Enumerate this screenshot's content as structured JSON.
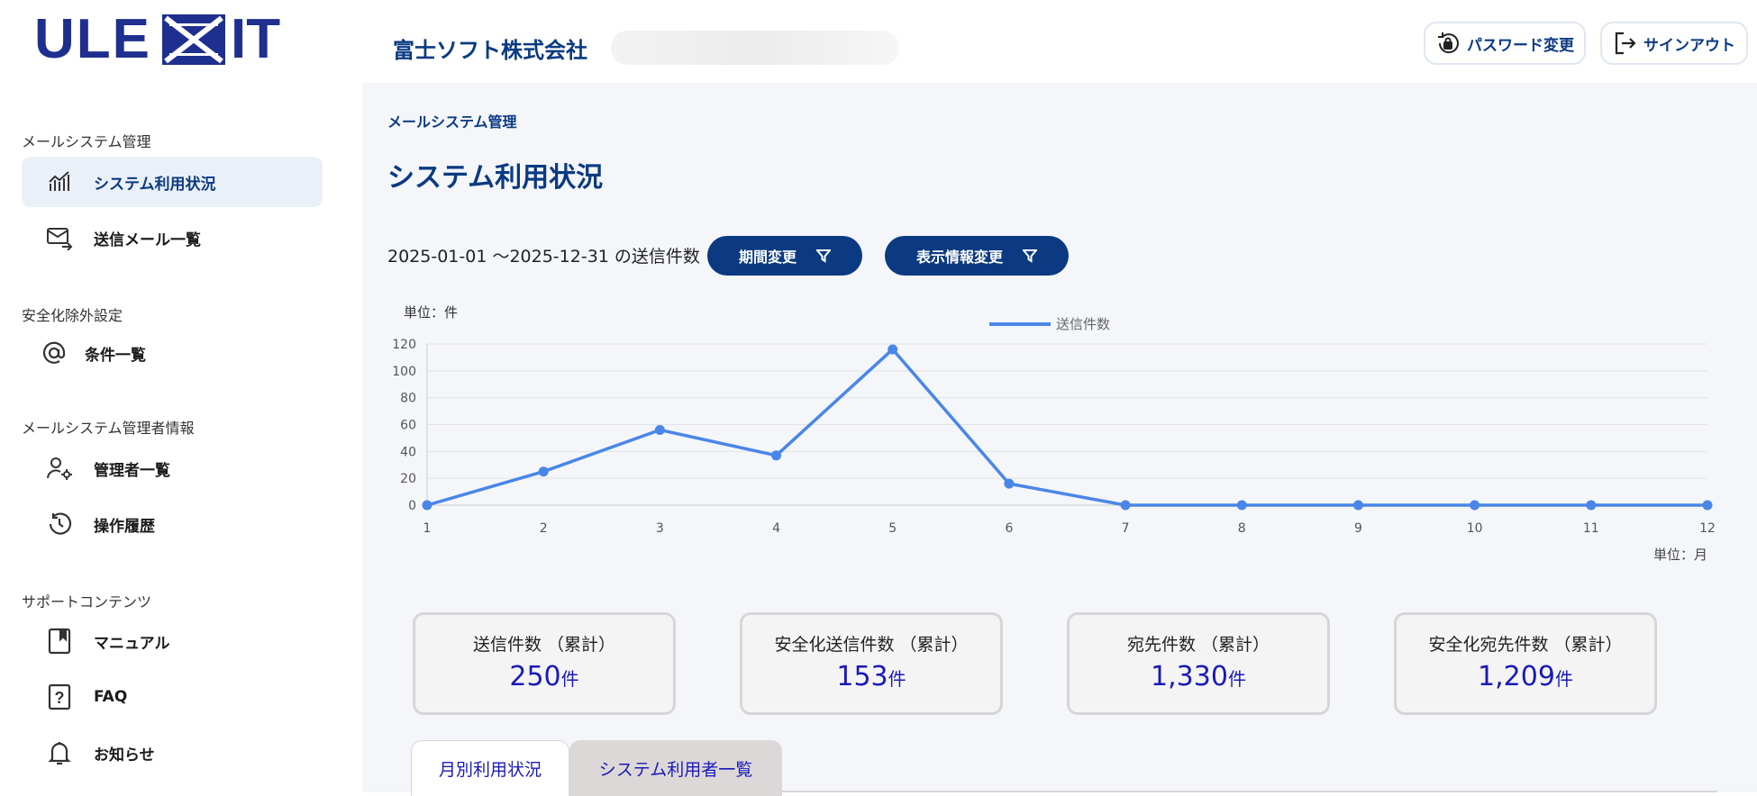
{
  "app": {
    "logo_text": "ULEXIT"
  },
  "header": {
    "company": "富士ソフト株式会社",
    "password_button": "パスワード変更",
    "signout_button": "サインアウト"
  },
  "sidebar": {
    "sections": [
      {
        "title": "メールシステム管理",
        "items": [
          {
            "label": "システム利用状況",
            "icon": "chart-icon",
            "active": true
          },
          {
            "label": "送信メール一覧",
            "icon": "mail-send-icon"
          }
        ]
      },
      {
        "title": "安全化除外設定",
        "items": [
          {
            "label": "条件一覧",
            "icon": "at-icon"
          }
        ]
      },
      {
        "title": "メールシステム管理者情報",
        "items": [
          {
            "label": "管理者一覧",
            "icon": "user-gear-icon"
          },
          {
            "label": "操作履歴",
            "icon": "history-icon"
          }
        ]
      },
      {
        "title": "サポートコンテンツ",
        "items": [
          {
            "label": "マニュアル",
            "icon": "book-icon"
          },
          {
            "label": "FAQ",
            "icon": "question-icon"
          },
          {
            "label": "お知らせ",
            "icon": "bell-icon"
          }
        ]
      }
    ]
  },
  "main": {
    "breadcrumb": "メールシステム管理",
    "title": "システム利用状況",
    "period_text": "2025-01-01 〜2025-12-31 の送信件数",
    "period_button": "期間変更",
    "display_button": "表示情報変更"
  },
  "chart_data": {
    "type": "line",
    "unit_y": "単位：件",
    "unit_x": "単位：月",
    "x": [
      1,
      2,
      3,
      4,
      5,
      6,
      7,
      8,
      9,
      10,
      11,
      12
    ],
    "series": [
      {
        "name": "送信件数",
        "color": "#4a86e8",
        "values": [
          0,
          25,
          56,
          37,
          116,
          16,
          0,
          0,
          0,
          0,
          0,
          0
        ]
      }
    ],
    "ylim": [
      0,
      120
    ],
    "yticks": [
      0,
      20,
      40,
      60,
      80,
      100,
      120
    ],
    "grid": true,
    "legend": "top-center"
  },
  "cards": [
    {
      "label": "送信件数 （累計）",
      "value": "250",
      "unit": "件"
    },
    {
      "label": "安全化送信件数 （累計）",
      "value": "153",
      "unit": "件"
    },
    {
      "label": "宛先件数 （累計）",
      "value": "1,330",
      "unit": "件"
    },
    {
      "label": "安全化宛先件数 （累計）",
      "value": "1,209",
      "unit": "件"
    }
  ],
  "tabs": [
    {
      "label": "月別利用状況",
      "active": true
    },
    {
      "label": "システム利用者一覧",
      "active": false
    }
  ]
}
